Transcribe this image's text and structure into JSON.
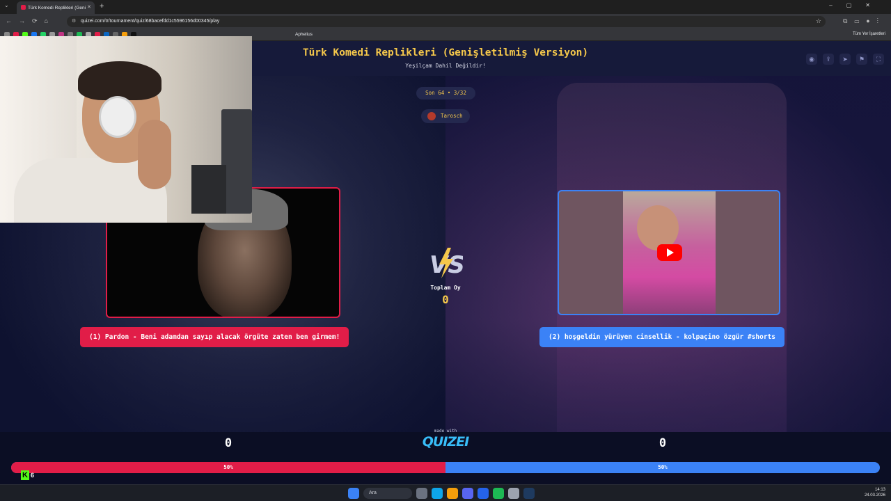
{
  "browser": {
    "tab_title": "Türk Komedi Replikleri (Geni",
    "url": "quizei.com/tr/tournament/quiz/68bacefdd1c5596156d00345/play",
    "bookmark_label": "Aphelius",
    "all_bookmarks": "Tüm Yer İşaretleri"
  },
  "header": {
    "title": "Türk Komedi Replikleri (Genişletilmiş Versiyon)",
    "subtitle": "Yeşilçam Dahil Değildir!",
    "icons": [
      "eye-icon",
      "share-icon",
      "send-icon",
      "flag-icon",
      "fullscreen-icon"
    ]
  },
  "match": {
    "round": "Son 64 • 3/32",
    "user": "Tarosch",
    "total_label": "Toplam Oy",
    "total_value": "0"
  },
  "left": {
    "label": "(1) Pardon - Beni adamdan sayıp alacak örgüte zaten ben girmem!",
    "score": "0",
    "percent_text": "50%",
    "percent_value": 50,
    "color": "#e11d48"
  },
  "right": {
    "label": "(2) hoşgeldin yürüyen cinsellik - kolpaçino özgür #shorts",
    "score": "0",
    "percent_text": "50%",
    "percent_value": 50,
    "color": "#3b82f6"
  },
  "footer": {
    "made_with": "made with",
    "brand": "QUIZEI"
  },
  "overlay": {
    "viewer_count": "6"
  },
  "taskbar": {
    "search_label": "Ara",
    "time": "14:13",
    "date": "24.03.2026"
  }
}
